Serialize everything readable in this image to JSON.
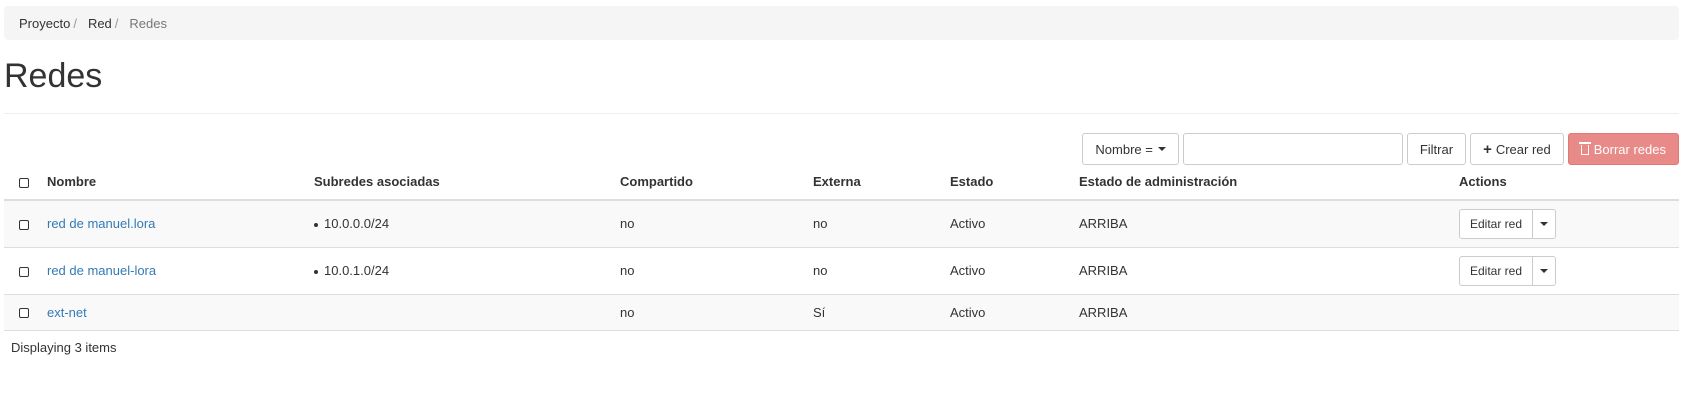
{
  "breadcrumb": {
    "items": [
      {
        "label": "Proyecto"
      },
      {
        "label": "Red"
      },
      {
        "label": "Redes"
      }
    ],
    "separator": "/"
  },
  "page": {
    "title": "Redes"
  },
  "toolbar": {
    "filter_field_label": "Nombre =",
    "filter_value": "",
    "filter_button": "Filtrar",
    "create_button": "Crear red",
    "delete_button": "Borrar redes"
  },
  "table": {
    "columns": {
      "name": "Nombre",
      "subnets": "Subredes asociadas",
      "shared": "Compartido",
      "external": "Externa",
      "status": "Estado",
      "admin_state": "Estado de administración",
      "actions": "Actions"
    },
    "rows": [
      {
        "name": "red de manuel.lora",
        "subnet": "10.0.0.0/24",
        "shared": "no",
        "external": "no",
        "status": "Activo",
        "admin_state": "ARRIBA",
        "action": "Editar red"
      },
      {
        "name": "red de manuel-lora",
        "subnet": "10.0.1.0/24",
        "shared": "no",
        "external": "no",
        "status": "Activo",
        "admin_state": "ARRIBA",
        "action": "Editar red"
      },
      {
        "name": "ext-net",
        "subnet": "",
        "shared": "no",
        "external": "Sí",
        "status": "Activo",
        "admin_state": "ARRIBA",
        "action": ""
      }
    ]
  },
  "footer": {
    "summary": "Displaying 3 items"
  },
  "colors": {
    "link": "#337ab7",
    "danger": "#e78a88",
    "breadcrumb_bg": "#f5f5f5"
  }
}
